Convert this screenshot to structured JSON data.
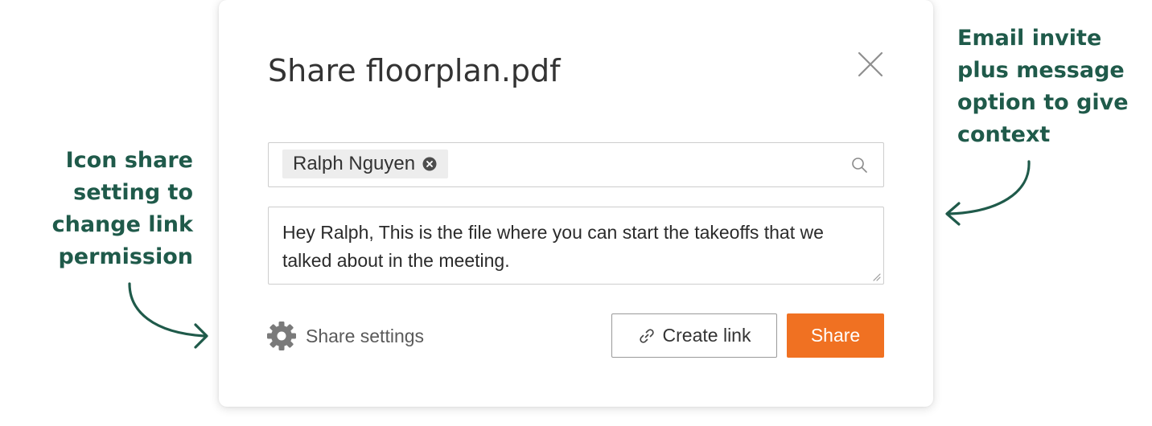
{
  "annotations": {
    "left": "Icon share\nsetting to\nchange link\npermission",
    "right": "Email invite\nplus message\noption to give\ncontext"
  },
  "dialog": {
    "title": "Share floorplan.pdf",
    "recipient": {
      "chip_label": "Ralph Nguyen"
    },
    "message": {
      "text": "Hey Ralph, This is the file where you can start the takeoffs that we talked about in the meeting."
    },
    "share_settings_label": "Share settings",
    "create_link_label": "Create link",
    "share_label": "Share"
  },
  "icons": {
    "close": "close-icon",
    "chip_remove": "close-circle-icon",
    "search": "search-icon",
    "settings": "gear-icon",
    "link": "link-icon",
    "resize": "resize-handle-icon",
    "annotation_arrow": "curved-arrow-icon"
  },
  "colors": {
    "annotation": "#1f5a4a",
    "primary_button": "#f07122",
    "primary_button_text": "#ffffff",
    "chip_background": "#ededed",
    "title_text": "#333333"
  }
}
